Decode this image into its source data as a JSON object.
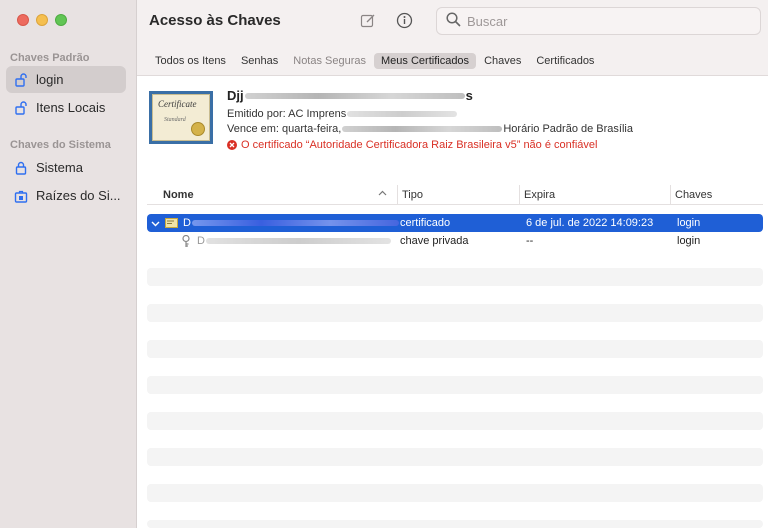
{
  "app": {
    "title": "Acesso às Chaves"
  },
  "sidebar": {
    "section_default": "Chaves Padrão",
    "section_system": "Chaves do Sistema",
    "items": [
      {
        "label": "login",
        "icon": "lock-open-icon"
      },
      {
        "label": "Itens Locais",
        "icon": "lock-open-icon"
      },
      {
        "label": "Sistema",
        "icon": "lock-icon"
      },
      {
        "label": "Raízes do Si...",
        "icon": "cabinet-lock-icon"
      }
    ]
  },
  "search": {
    "placeholder": "Buscar",
    "value": ""
  },
  "tabs": [
    {
      "label": "Todos os Itens"
    },
    {
      "label": "Senhas"
    },
    {
      "label": "Notas Seguras"
    },
    {
      "label": "Meus Certificados"
    },
    {
      "label": "Chaves"
    },
    {
      "label": "Certificados"
    }
  ],
  "certificate": {
    "image_title": "Certificate",
    "image_subtitle": "Standard",
    "name_prefix": "Djj",
    "name_suffix": "s",
    "issuer_label": "Emitido por: AC Imprens",
    "expires_label": "Vence em: quarta-feira,",
    "expires_suffix": "Horário Padrão de Brasília",
    "warning": "O certificado “Autoridade Certificadora Raiz Brasileira v5” não é confiável"
  },
  "table": {
    "columns": [
      "Nome",
      "Tipo",
      "Expira",
      "Chaves"
    ],
    "rows": [
      {
        "name_prefix": "D",
        "tipo": "certificado",
        "expira": "6 de jul. de 2022 14:09:23",
        "chaves": "login"
      },
      {
        "name_prefix": "D",
        "tipo": "chave privada",
        "expira": "--",
        "chaves": "login"
      }
    ]
  },
  "colors": {
    "accent": "#1f5fd6",
    "error": "#d93025"
  }
}
